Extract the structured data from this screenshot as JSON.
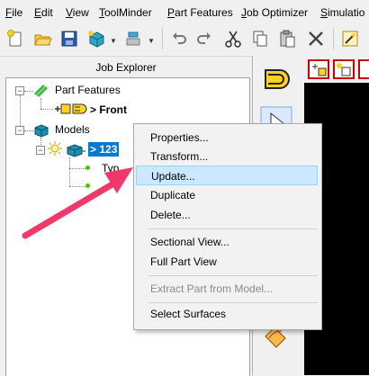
{
  "menubar": {
    "items": [
      "File",
      "Edit",
      "View",
      "ToolMinder",
      "Part Features",
      "Job Optimizer",
      "Simulatio"
    ]
  },
  "toolbar": {
    "buttons": [
      "new-icon",
      "open-icon",
      "save-icon",
      "add-part-icon",
      "tool-icon",
      "undo-icon",
      "redo-icon",
      "cut-icon",
      "copy-icon",
      "paste-icon",
      "delete-icon",
      "wizard-icon"
    ]
  },
  "explorer": {
    "title": "Job Explorer",
    "part_features_label": "Part Features",
    "front_label": "> Front",
    "models_label": "Models",
    "model_selected_label": "> 123",
    "child_typ_label": "Typ"
  },
  "context_menu": {
    "properties": "Properties...",
    "transform": "Transform...",
    "update": "Update...",
    "duplicate": "Duplicate",
    "delete": "Delete...",
    "sectional_view": "Sectional View...",
    "full_part_view": "Full Part View",
    "extract_part": "Extract Part from Model...",
    "select_surfaces": "Select Surfaces"
  },
  "colors": {
    "selection": "#0078d7",
    "highlight": "#cce8ff",
    "arrow": "#f0386b",
    "viewport": "#000000"
  }
}
